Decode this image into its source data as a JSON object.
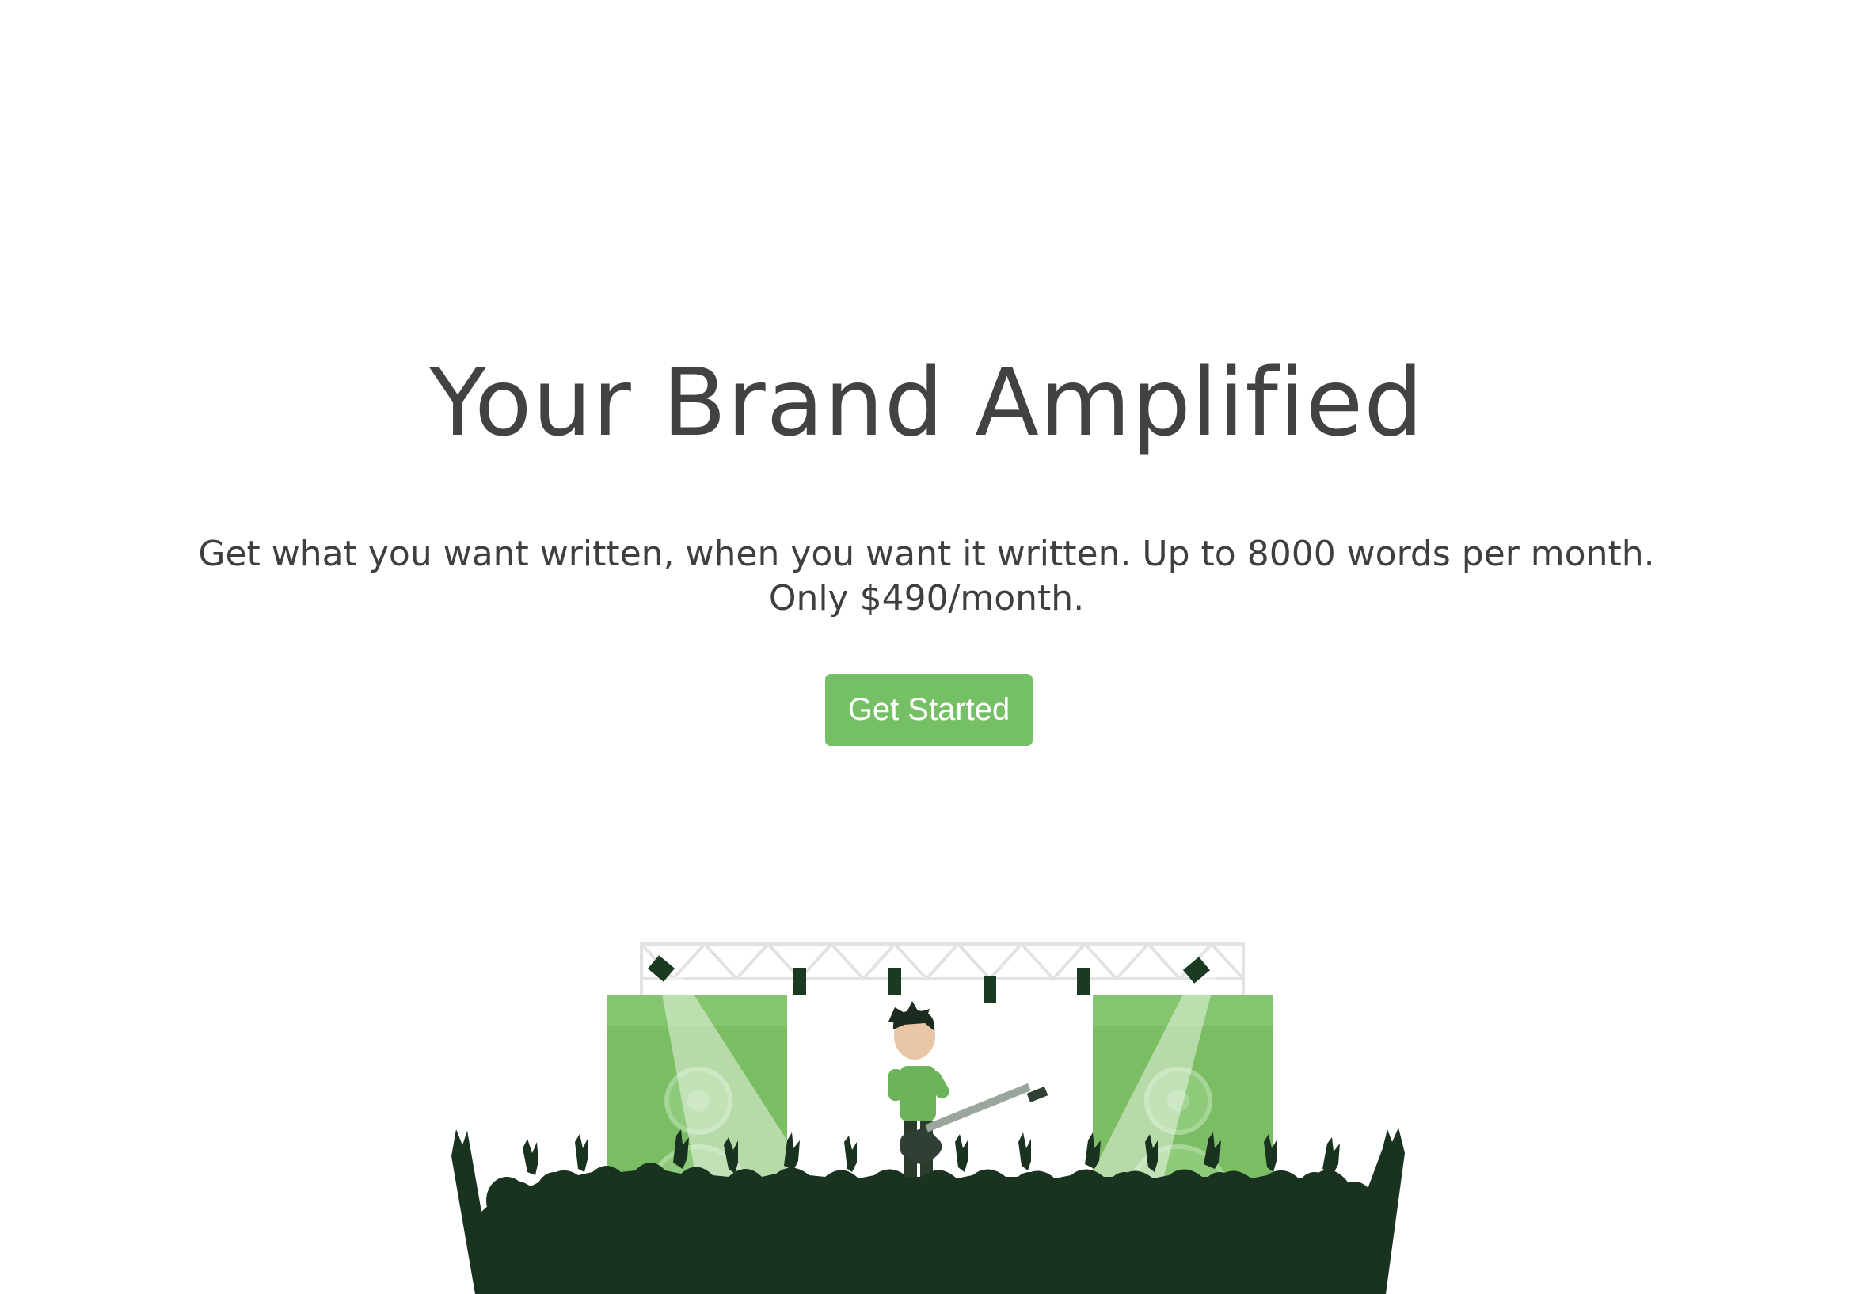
{
  "hero": {
    "title": "Your Brand Amplified",
    "subtitle": "Get what you want written, when you want it written. Up to 8000 words per month. Only $490/month.",
    "cta_label": "Get Started"
  },
  "colors": {
    "accent": "#75c064",
    "heading_text": "#424242",
    "body_text": "#3f3f3f",
    "crowd": "#1a3320",
    "speaker": "#7bbd63",
    "truss": "#e4e4e4"
  },
  "illustration": {
    "icon": "concert-stage-illustration"
  }
}
